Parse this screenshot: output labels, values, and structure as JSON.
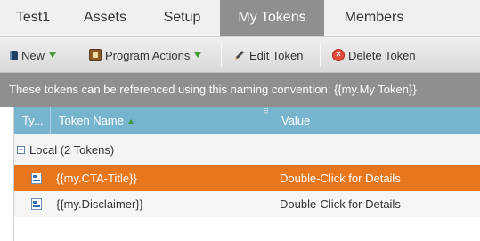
{
  "tabs": [
    {
      "label": "Test1",
      "active": false
    },
    {
      "label": "Assets",
      "active": false
    },
    {
      "label": "Setup",
      "active": false
    },
    {
      "label": "My Tokens",
      "active": true
    },
    {
      "label": "Members",
      "active": false
    }
  ],
  "toolbar": {
    "new_label": "New",
    "program_actions_label": "Program Actions",
    "edit_token_label": "Edit Token",
    "delete_token_label": "Delete Token"
  },
  "info": {
    "text": "These tokens can be referenced using this naming convention: {{my.My Token}}"
  },
  "grid": {
    "columns": [
      "Ty...",
      "Token Name",
      "Value"
    ],
    "sorted_column": "Token Name",
    "group": {
      "label": "Local (2 Tokens)",
      "expanded": true
    },
    "rows": [
      {
        "icon": "token-icon",
        "name": "{{my.CTA-Title}}",
        "value": "Double-Click for Details",
        "selected": true
      },
      {
        "icon": "token-icon",
        "name": "{{my.Disclaimer}}",
        "value": "Double-Click for Details",
        "selected": false
      }
    ]
  },
  "colors": {
    "active_tab": "#8f8f8f",
    "header": "#77b4ce",
    "selected_row": "#e8761d"
  }
}
